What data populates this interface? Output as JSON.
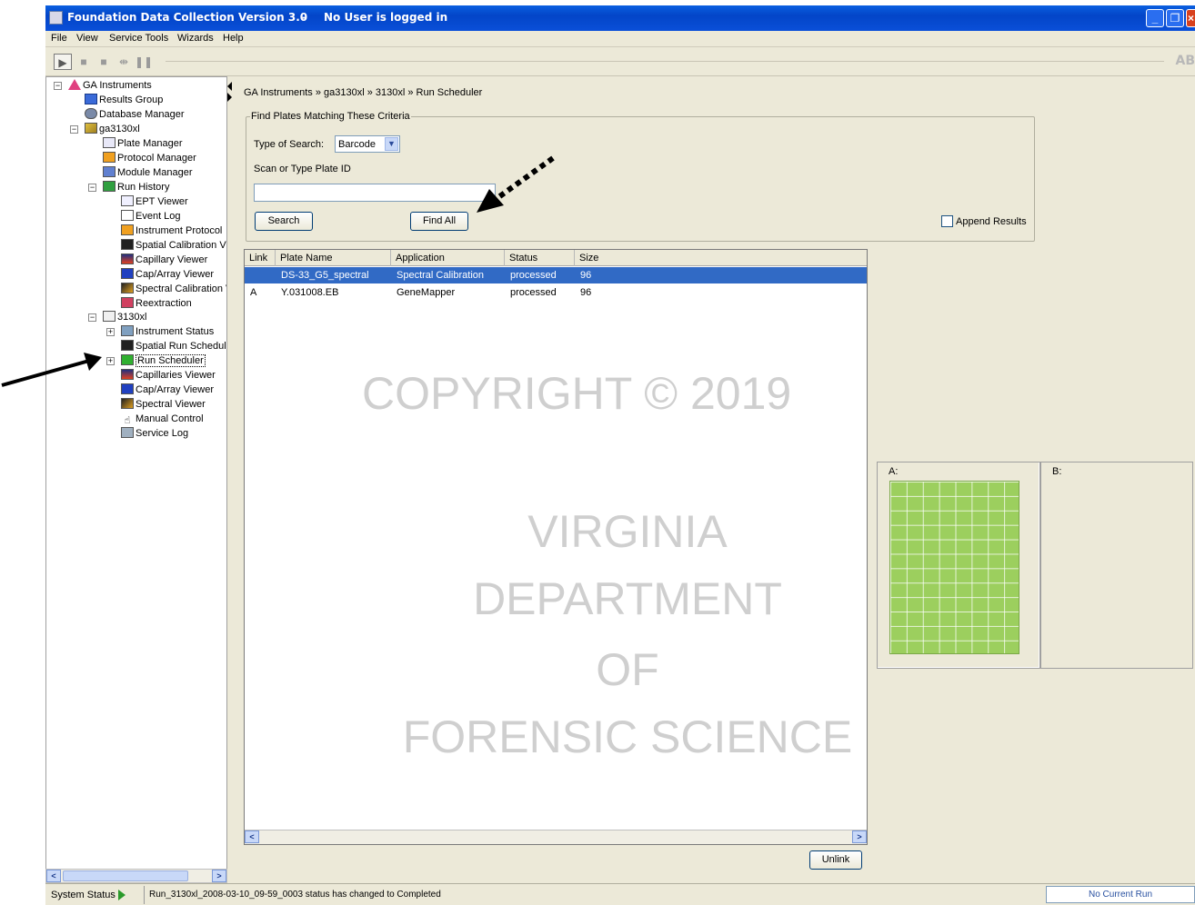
{
  "window": {
    "title": "Foundation Data Collection Version 3.0",
    "separator": "-",
    "user_status": "No User is logged in",
    "controls": [
      "minimize-icon",
      "restore-icon",
      "close-icon"
    ]
  },
  "menu": [
    "File",
    "View",
    "Service Tools",
    "Wizards",
    "Help"
  ],
  "toolbar": {
    "buttons": [
      "play-icon",
      "stop-icon",
      "pause-icon",
      "skip-icon",
      "pause-bars-icon"
    ],
    "logo": "AB"
  },
  "tree": {
    "root": "GA Instruments",
    "results_group": "Results Group",
    "database_manager": "Database Manager",
    "instrument": "ga3130xl",
    "plate_manager": "Plate Manager",
    "protocol_manager": "Protocol Manager",
    "module_manager": "Module Manager",
    "run_history": "Run History",
    "ept_viewer": "EPT Viewer",
    "event_log": "Event Log",
    "instrument_protocol": "Instrument Protocol",
    "spatial_calibration_viewer": "Spatial Calibration Vi",
    "capillary_viewer": "Capillary Viewer",
    "caparray_viewer": "Cap/Array Viewer",
    "spectral_calibration_viewer": "Spectral Calibration V",
    "reextraction": "Reextraction",
    "model": "3130xl",
    "instrument_status": "Instrument Status",
    "spatial_run_scheduler": "Spatial Run Schedule",
    "run_scheduler": "Run Scheduler",
    "capillaries_viewer": "Capillaries Viewer",
    "caparray_viewer_2": "Cap/Array Viewer",
    "spectral_viewer": "Spectral Viewer",
    "manual_control": "Manual Control",
    "service_log": "Service Log"
  },
  "breadcrumb": "GA Instruments » ga3130xl » 3130xl » Run Scheduler",
  "find": {
    "legend": "Find Plates Matching These Criteria",
    "type_label": "Type of Search:",
    "type_value": "Barcode",
    "scan_label": "Scan or Type Plate ID",
    "scan_value": "",
    "search_button": "Search",
    "find_all_button": "Find All",
    "append_label": "Append Results",
    "append_checked": false
  },
  "table": {
    "columns": [
      "Link",
      "Plate Name",
      "Application",
      "Status",
      "Size"
    ],
    "rows": [
      {
        "link": "",
        "plate_name": "DS-33_G5_spectral",
        "application": "Spectral Calibration",
        "status": "processed",
        "size": "96",
        "selected": true
      },
      {
        "link": "A",
        "plate_name": "Y.031008.EB",
        "application": "GeneMapper",
        "status": "processed",
        "size": "96",
        "selected": false
      }
    ],
    "unlink_button": "Unlink"
  },
  "plates": {
    "a_label": "A:",
    "b_label": "B:",
    "well_color": "#9ccf5e"
  },
  "watermark": {
    "line1": "COPYRIGHT © 2019",
    "line2": "VIRGINIA",
    "line3": "DEPARTMENT",
    "line4": "OF",
    "line5": "FORENSIC SCIENCE"
  },
  "status": {
    "system_label": "System Status",
    "message": "Run_3130xl_2008-03-10_09-59_0003 status has changed to Completed",
    "current_run": "No Current Run"
  },
  "colors": {
    "titlebar": "#0345c8",
    "selection": "#316ac5",
    "chrome": "#ece9d8"
  }
}
